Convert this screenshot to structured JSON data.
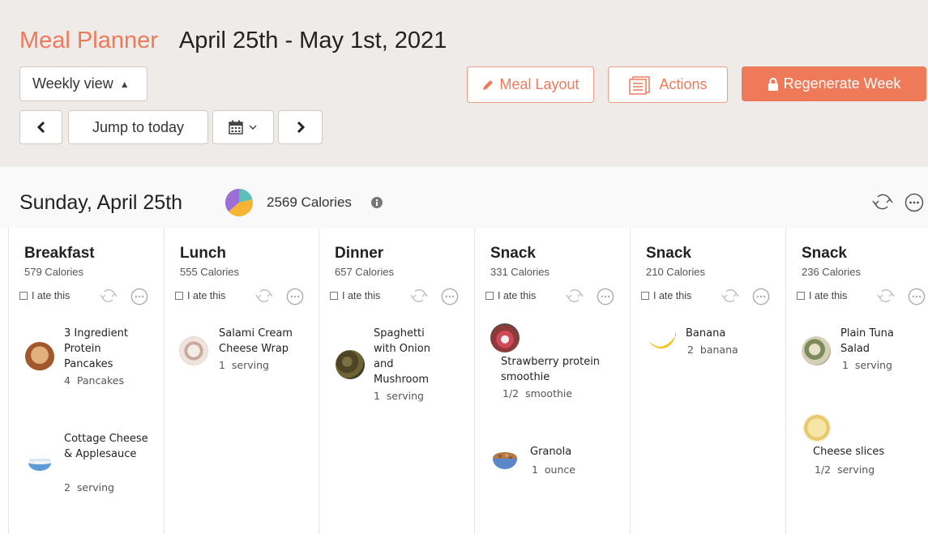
{
  "header": {
    "app_title": "Meal Planner",
    "date_range": "April 25th - May 1st, 2021",
    "view_select": "Weekly view",
    "jump_today": "Jump to today",
    "meal_layout": "Meal Layout",
    "actions": "Actions",
    "regenerate": "Regenerate Week"
  },
  "day": {
    "title": "Sunday, April 25th",
    "calories": "2569 Calories"
  },
  "ate_label": "I ate this",
  "meals": [
    {
      "name": "Breakfast",
      "calories": "579 Calories",
      "foods": [
        {
          "name": "3 Ingredient Protein Pancakes",
          "qty": "4",
          "unit": "Pancakes",
          "icon": "pancakes"
        },
        {
          "name": "Cottage Cheese & Applesauce",
          "qty": "2",
          "unit": "serving",
          "icon": "cottage-cheese-bowl"
        }
      ]
    },
    {
      "name": "Lunch",
      "calories": "555 Calories",
      "foods": [
        {
          "name": "Salami Cream Cheese Wrap",
          "qty": "1",
          "unit": "serving",
          "icon": "wrap"
        }
      ]
    },
    {
      "name": "Dinner",
      "calories": "657 Calories",
      "foods": [
        {
          "name": "Spaghetti with Onion and Mushroom",
          "qty": "1",
          "unit": "serving",
          "icon": "spaghetti"
        }
      ]
    },
    {
      "name": "Snack",
      "calories": "331 Calories",
      "foods": [
        {
          "name": "Strawberry protein smoothie",
          "qty": "1/2",
          "unit": "smoothie",
          "icon": "smoothie"
        },
        {
          "name": "Granola",
          "qty": "1",
          "unit": "ounce",
          "icon": "granola-bowl"
        }
      ]
    },
    {
      "name": "Snack",
      "calories": "210 Calories",
      "foods": [
        {
          "name": "Banana",
          "qty": "2",
          "unit": "banana",
          "icon": "banana"
        }
      ]
    },
    {
      "name": "Snack",
      "calories": "236 Calories",
      "foods": [
        {
          "name": "Plain Tuna Salad",
          "qty": "1",
          "unit": "serving",
          "icon": "tuna-salad"
        },
        {
          "name": "Cheese slices",
          "qty": "1/2",
          "unit": "serving",
          "icon": "cheese-slices"
        }
      ]
    }
  ],
  "colors": {
    "accent": "#ef7a5a",
    "header_bg": "#eeebe8",
    "pie_purple": "#9b6fd6",
    "pie_teal": "#5bc0b8",
    "pie_yellow": "#f5b531"
  }
}
